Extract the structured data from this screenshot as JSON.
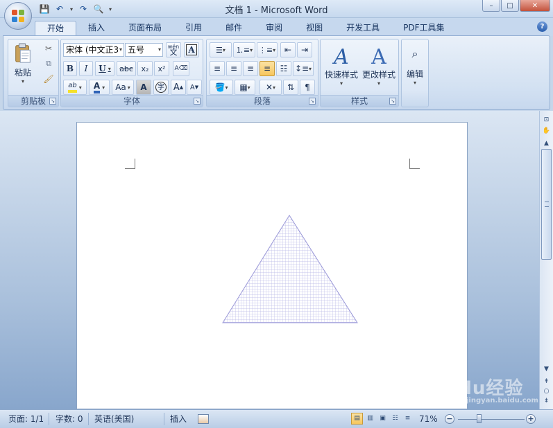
{
  "window": {
    "title": "文档 1 - Microsoft Word",
    "controls": {
      "minimize": "–",
      "maximize": "□",
      "close": "✕"
    }
  },
  "quick_access": [
    {
      "icon": "save-icon",
      "glyph": "💾"
    },
    {
      "icon": "undo-icon",
      "glyph": "↶"
    },
    {
      "icon": "redo-icon",
      "glyph": "↷"
    },
    {
      "icon": "print-preview-icon",
      "glyph": "🔍"
    }
  ],
  "tabs": [
    "开始",
    "插入",
    "页面布局",
    "引用",
    "邮件",
    "审阅",
    "视图",
    "开发工具",
    "PDF工具集"
  ],
  "active_tab": "开始",
  "help_glyph": "?",
  "ribbon": {
    "clipboard": {
      "group_label": "剪贴板",
      "paste_label": "粘贴"
    },
    "font": {
      "group_label": "字体",
      "font_name": "宋体 (中文正3",
      "font_size": "五号",
      "phonetic_glyph": "wén",
      "bold": "B",
      "italic": "I",
      "underline": "U",
      "strike": "abc",
      "subscript": "x₂",
      "superscript": "x²",
      "case": "Aa",
      "char_shade": "A",
      "enclose": "字",
      "grow": "A",
      "shrink": "A"
    },
    "paragraph": {
      "group_label": "段落"
    },
    "styles": {
      "group_label": "样式",
      "quick_styles": "快速样式",
      "change_styles": "更改样式"
    },
    "editing": {
      "label": "编辑"
    }
  },
  "statusbar": {
    "page": "页面: 1/1",
    "words": "字数: 0",
    "language": "英语(美国)",
    "mode": "插入",
    "zoom": "71%",
    "zoom_percent": 71
  },
  "watermark": {
    "text": "Baidu经验",
    "sub": "jingyan.baidu.com"
  },
  "colors": {
    "highlight": "#f5e12a",
    "font_color": "#2f63b7",
    "shape_outline": "#9a98d8",
    "shape_grid": "#b9b8e6"
  }
}
